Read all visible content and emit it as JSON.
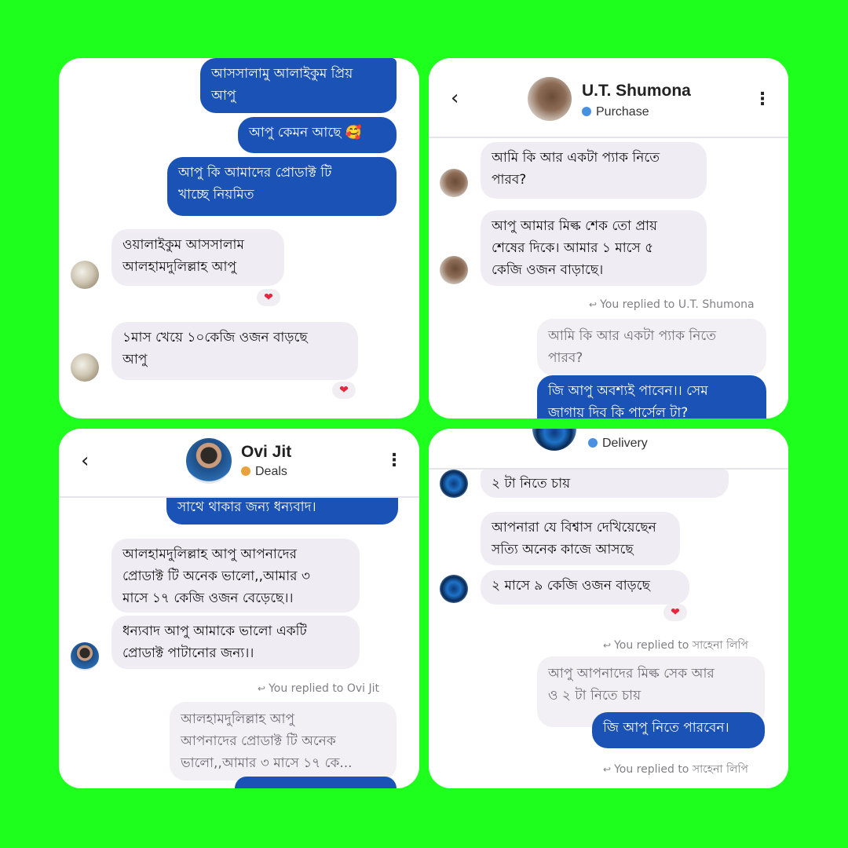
{
  "panel1": {
    "messages": [
      {
        "text": "আসসালামু আলাইকুম প্রিয়\nআপু"
      },
      {
        "text": "আপু কেমন আছে 🥰"
      },
      {
        "text": "আপু কি আমাদের প্রোডাক্ট টি\nখাচ্ছে নিয়মিত"
      },
      {
        "text": "ওয়ালাইকুম আসসালাম\nআলহামদুলিল্লাহ আপু"
      },
      {
        "text": "১মাস খেয়ে ১০কেজি ওজন বাড়ছে\nআপু"
      }
    ],
    "reaction": "❤"
  },
  "panel2": {
    "header": {
      "back": "‹",
      "name": "U.T. Shumona",
      "label": "Purchase",
      "label_color": "#4a90e2",
      "more": "⋮"
    },
    "messages": [
      {
        "text": "আমি কি আর একটা প্যাক নিতে\nপারব?"
      },
      {
        "text": "আপু আমার মিল্ক শেক তো প্রায়\nশেষের দিকে। আমার ১ মাসে ৫\nকেজি ওজন বাড়াছে।"
      }
    ],
    "replied": "You replied to U.T. Shumona",
    "quoted": "আমি কি আর একটা প্যাক নিতে\nপারব?",
    "reply": "জি আপু অবশ্যই পাবেন।। সেম\nজাগায় দিব কি পার্সেল টা?"
  },
  "panel3": {
    "header": {
      "back": "‹",
      "name": "Ovi Jit",
      "label": "Deals",
      "label_color": "#e8a23c",
      "more": "⋮"
    },
    "messages": [
      {
        "text": "সাথে থাকার জন্য ধন্যবাদ।"
      },
      {
        "text": "আলহামদুলিল্লাহ আপু আপনাদের\nপ্রোডাক্ট টি অনেক ভালো,,আমার ৩\nমাসে ১৭ কেজি ওজন বেড়েছে।।"
      },
      {
        "text": "ধন্যবাদ আপু আমাকে ভালো একটি\nপ্রোডাক্ট পাটানোর জন্য।।"
      }
    ],
    "replied": "You replied to Ovi Jit",
    "quoted": "আলহামদুলিল্লাহ আপু\nআপনাদের প্রোডাক্ট টি অনেক\nভালো,,আমার ৩ মাসে ১৭ কে..."
  },
  "panel4": {
    "header": {
      "label": "Delivery",
      "label_color": "#4a90e2"
    },
    "messages": [
      {
        "text": "২ টা নিতে চায়"
      },
      {
        "text": "আপনারা যে বিশ্বাস দেখিয়েছেন\nসত্যি অনেক কাজে আসছে"
      },
      {
        "text": "২ মাসে ৯ কেজি ওজন বাড়ছে"
      }
    ],
    "reaction": "❤",
    "replied1": "You replied to সাহেনা লিপি",
    "quoted": "আপু আপনাদের মিল্ক সেক আর\nও ২ টা নিতে চায়",
    "reply": "জি আপু নিতে পারবেন।",
    "replied2": "You replied to সাহেনা লিপি"
  }
}
